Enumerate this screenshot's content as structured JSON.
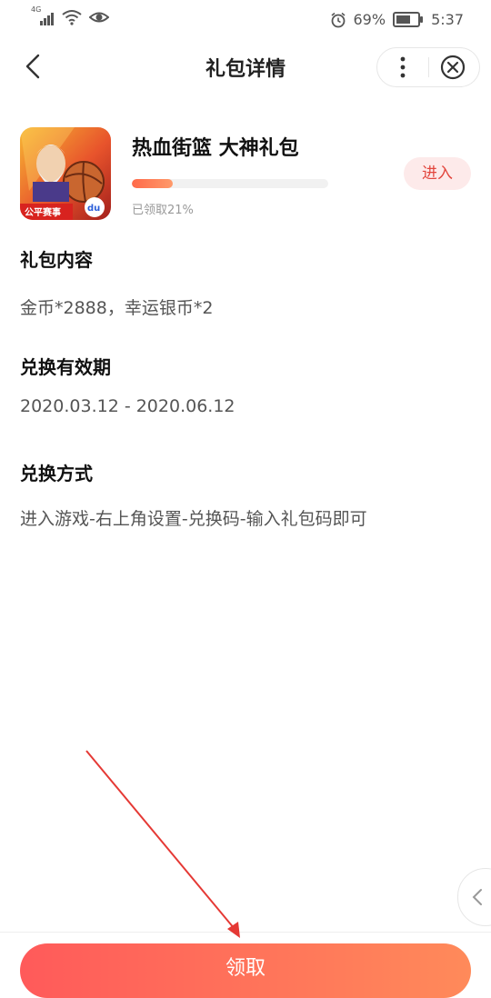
{
  "status_bar": {
    "network": "4G",
    "battery_percent": "69%",
    "time": "5:37",
    "battery_level": 0.69
  },
  "nav": {
    "title": "礼包详情",
    "icons": [
      "back-arrow-icon",
      "more-vertical-icon",
      "close-circle-icon"
    ]
  },
  "gift": {
    "game_name": "热血街篮 大神礼包",
    "claimed_text": "已领取21%",
    "claimed_ratio": 0.21,
    "enter_label": "进入",
    "icon_badge_text": "公平赛事",
    "icon_brand_text": "du"
  },
  "sections": [
    {
      "heading": "礼包内容",
      "body": "金币*2888，幸运银币*2"
    },
    {
      "heading": "兑换有效期",
      "body": "2020.03.12 - 2020.06.12"
    },
    {
      "heading": "兑换方式",
      "body": "进入游戏-右上角设置-兑换码-输入礼包码即可"
    }
  ],
  "actions": {
    "claim_label": "领取"
  },
  "colors": {
    "accent": "#e2463d",
    "button_gradient_start": "#ff5a5a",
    "button_gradient_end": "#ff8a5a",
    "annotation_arrow": "#e53935"
  }
}
